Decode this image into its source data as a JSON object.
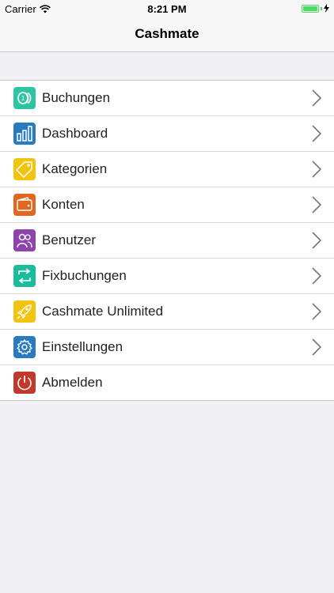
{
  "status_bar": {
    "carrier": "Carrier",
    "time": "8:21 PM",
    "wifi_icon": "wifi-icon",
    "battery_level": 1.0,
    "battery_color": "#4cd964"
  },
  "nav": {
    "title": "Cashmate"
  },
  "menu": [
    {
      "label": "Buchungen",
      "icon": "coins-icon",
      "color": "#2ec4a1",
      "has_chevron": true
    },
    {
      "label": "Dashboard",
      "icon": "bar-chart-icon",
      "color": "#2a7ac0",
      "has_chevron": true
    },
    {
      "label": "Kategorien",
      "icon": "tag-icon",
      "color": "#f1c40f",
      "has_chevron": true
    },
    {
      "label": "Konten",
      "icon": "wallet-icon",
      "color": "#e2661f",
      "has_chevron": true
    },
    {
      "label": "Benutzer",
      "icon": "users-icon",
      "color": "#8e44ad",
      "has_chevron": true
    },
    {
      "label": "Fixbuchungen",
      "icon": "repeat-icon",
      "color": "#1abc9c",
      "has_chevron": true
    },
    {
      "label": "Cashmate Unlimited",
      "icon": "rocket-icon",
      "color": "#f1c40f",
      "has_chevron": true
    },
    {
      "label": "Einstellungen",
      "icon": "gear-icon",
      "color": "#2a7ac0",
      "has_chevron": true
    },
    {
      "label": "Abmelden",
      "icon": "power-icon",
      "color": "#c0392b",
      "has_chevron": false
    }
  ]
}
